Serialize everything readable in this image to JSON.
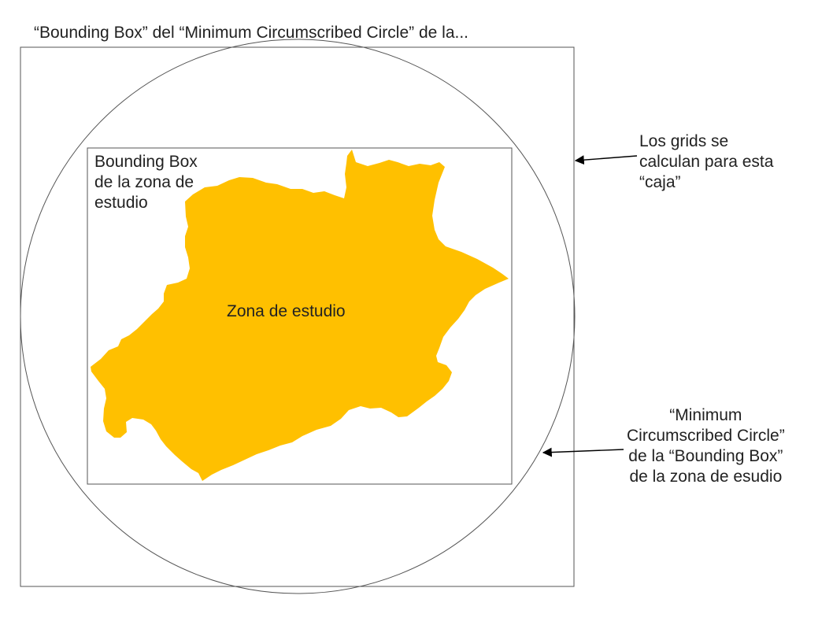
{
  "title": "“Bounding Box” del “Minimum Circumscribed Circle” de la...",
  "bbox_label": [
    "Bounding Box",
    "de la zona de",
    "estudio"
  ],
  "zone_label": "Zona de estudio",
  "grids_note": [
    "Los grids se",
    "calculan para esta",
    "“caja”"
  ],
  "circle_note": [
    "“Minimum",
    "Circumscribed Circle”",
    "de la “Bounding Box”",
    "de la zona de esudio"
  ],
  "colors": {
    "zone_fill": "#ffc000",
    "lines": "#555555",
    "text": "#222222"
  },
  "icons": {
    "arrow_to_outer_box": "arrow-left-icon",
    "arrow_to_circle": "arrow-left-icon"
  }
}
